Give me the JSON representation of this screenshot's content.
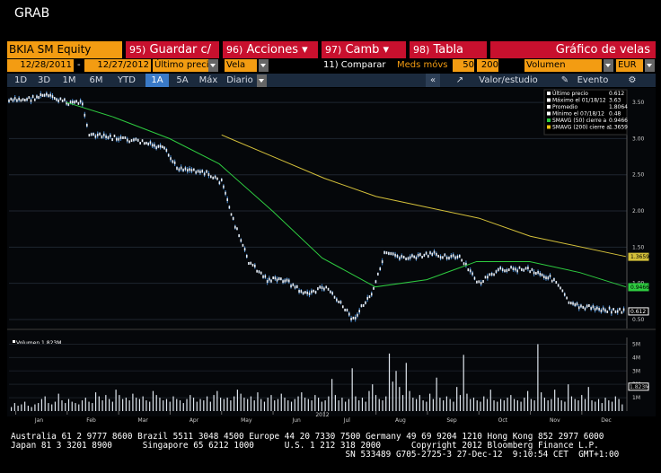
{
  "header": {
    "title": "GRAB"
  },
  "toolbar": {
    "ticker": "BKIA SM Equity",
    "buttons": [
      {
        "num": "95)",
        "label": "Guardar c/"
      },
      {
        "num": "96)",
        "label": "Acciones"
      },
      {
        "num": "97)",
        "label": "Camb"
      },
      {
        "num": "98)",
        "label": "Tabla"
      }
    ],
    "chart_title": "Gráfico de velas"
  },
  "settings": {
    "start_date": "12/28/2011",
    "end_date": "12/27/2012",
    "price_field": "Último preci",
    "chart_style": "Vela",
    "compare": "11) Comparar",
    "ma_label": "Meds móvs",
    "ma1": "50",
    "ma2": "200",
    "lower_field": "Volumen",
    "currency": "EUR"
  },
  "periods": [
    "1D",
    "3D",
    "1M",
    "6M",
    "YTD",
    "1A",
    "5A",
    "Máx"
  ],
  "selected_period": "1A",
  "frequency": "Diario",
  "study_label": "Valor/estudio",
  "event_label": "Evento",
  "colors": {
    "accent": "#f39c12",
    "red": "#c8102e",
    "bar": "#1b2a3d",
    "candle": "#5b9bd5",
    "sma50": "#2ecc40",
    "sma200": "#d4c03a"
  },
  "chart_data": {
    "type": "line",
    "x_ticks": [
      "Jan",
      "Feb",
      "Mar",
      "Apr",
      "May",
      "Jun",
      "Jul",
      "Aug",
      "Sep",
      "Oct",
      "Nov",
      "Dec"
    ],
    "year_label": "2012",
    "y_ticks": [
      "3.50",
      "3.00",
      "2.50",
      "2.00",
      "1.50",
      "1.00",
      "0.50"
    ],
    "ylim": [
      0.45,
      3.6
    ],
    "legend": [
      {
        "label": "Último precio",
        "value": "0.612"
      },
      {
        "label": "Máximo el 01/18/12",
        "value": "3.63"
      },
      {
        "label": "Promedio",
        "value": "1.8064"
      },
      {
        "label": "Mínimo el 07/18/12",
        "value": "0.48"
      },
      {
        "label": "SMAVG (50) cierre a",
        "value": "0.9466"
      },
      {
        "label": "SMAVG (200) cierre a",
        "value": "1.3659"
      }
    ],
    "right_labels": [
      "1.3659",
      "0.9466",
      "0.612"
    ],
    "price": [
      {
        "x": "Dec 28",
        "y": 3.52
      },
      {
        "x": "Jan 10",
        "y": 3.55
      },
      {
        "x": "Jan 18",
        "y": 3.6
      },
      {
        "x": "Jan 31",
        "y": 3.5
      },
      {
        "x": "Feb 10",
        "y": 3.5
      },
      {
        "x": "Feb 14",
        "y": 3.05
      },
      {
        "x": "Mar 01",
        "y": 3.0
      },
      {
        "x": "Mar 15",
        "y": 2.95
      },
      {
        "x": "Mar 28",
        "y": 2.85
      },
      {
        "x": "Apr 05",
        "y": 2.6
      },
      {
        "x": "Apr 20",
        "y": 2.55
      },
      {
        "x": "May 01",
        "y": 2.4
      },
      {
        "x": "May 09",
        "y": 1.8
      },
      {
        "x": "May 17",
        "y": 1.3
      },
      {
        "x": "May 28",
        "y": 1.05
      },
      {
        "x": "Jun 08",
        "y": 1.05
      },
      {
        "x": "Jun 20",
        "y": 0.85
      },
      {
        "x": "Jul 02",
        "y": 0.95
      },
      {
        "x": "Jul 18",
        "y": 0.5
      },
      {
        "x": "Jul 30",
        "y": 0.9
      },
      {
        "x": "Aug 06",
        "y": 1.4
      },
      {
        "x": "Aug 20",
        "y": 1.35
      },
      {
        "x": "Sep 05",
        "y": 1.4
      },
      {
        "x": "Sep 20",
        "y": 1.35
      },
      {
        "x": "Oct 01",
        "y": 1.0
      },
      {
        "x": "Oct 15",
        "y": 1.2
      },
      {
        "x": "Oct 30",
        "y": 1.2
      },
      {
        "x": "Nov 15",
        "y": 1.05
      },
      {
        "x": "Nov 25",
        "y": 0.7
      },
      {
        "x": "Dec 10",
        "y": 0.65
      },
      {
        "x": "Dec 27",
        "y": 0.61
      }
    ],
    "sma50": [
      {
        "x": "Jan 31",
        "y": 3.5
      },
      {
        "x": "Feb 28",
        "y": 3.3
      },
      {
        "x": "Mar 31",
        "y": 3.0
      },
      {
        "x": "Apr 30",
        "y": 2.65
      },
      {
        "x": "May 31",
        "y": 2.0
      },
      {
        "x": "Jun 30",
        "y": 1.35
      },
      {
        "x": "Jul 31",
        "y": 0.95
      },
      {
        "x": "Aug 31",
        "y": 1.05
      },
      {
        "x": "Sep 30",
        "y": 1.3
      },
      {
        "x": "Oct 31",
        "y": 1.3
      },
      {
        "x": "Nov 30",
        "y": 1.15
      },
      {
        "x": "Dec 27",
        "y": 0.95
      }
    ],
    "sma200": [
      {
        "x": "May 01",
        "y": 3.05
      },
      {
        "x": "Jun 01",
        "y": 2.75
      },
      {
        "x": "Jul 01",
        "y": 2.45
      },
      {
        "x": "Aug 01",
        "y": 2.2
      },
      {
        "x": "Sep 01",
        "y": 2.05
      },
      {
        "x": "Oct 01",
        "y": 1.9
      },
      {
        "x": "Nov 01",
        "y": 1.65
      },
      {
        "x": "Dec 27",
        "y": 1.37
      }
    ],
    "volume_label": "Volumen 1.823M",
    "volume_ticks": [
      "5M",
      "4M",
      "3M",
      "2M",
      "1M"
    ],
    "volume_last": "1.823M",
    "volume": [
      0.3,
      0.6,
      0.4,
      0.5,
      0.7,
      0.4,
      0.3,
      0.5,
      0.6,
      0.9,
      1.1,
      0.6,
      0.5,
      0.7,
      1.3,
      0.8,
      0.6,
      0.9,
      0.7,
      0.6,
      0.5,
      0.8,
      1.0,
      0.7,
      0.6,
      1.4,
      1.1,
      0.8,
      1.2,
      0.9,
      0.7,
      1.6,
      1.2,
      0.9,
      1.0,
      0.8,
      1.3,
      1.0,
      0.9,
      1.1,
      0.8,
      0.7,
      1.5,
      1.2,
      1.0,
      0.8,
      0.9,
      0.7,
      1.1,
      0.9,
      0.8,
      0.6,
      0.9,
      1.2,
      1.0,
      0.7,
      0.9,
      0.8,
      1.1,
      0.7,
      1.2,
      1.5,
      1.0,
      0.9,
      1.0,
      0.8,
      1.1,
      1.6,
      1.3,
      1.0,
      0.9,
      1.1,
      0.8,
      1.4,
      0.9,
      0.7,
      1.0,
      1.2,
      0.8,
      0.9,
      1.3,
      1.0,
      0.8,
      0.7,
      0.9,
      1.1,
      1.4,
      1.0,
      0.9,
      0.8,
      1.2,
      1.0,
      0.7,
      0.8,
      1.1,
      2.4,
      1.2,
      0.8,
      1.0,
      0.7,
      0.9,
      3.2,
      1.1,
      0.8,
      1.0,
      0.7,
      1.5,
      2.0,
      1.2,
      0.9,
      0.8,
      1.1,
      4.3,
      2.2,
      3.0,
      1.8,
      1.2,
      3.6,
      1.5,
      1.0,
      0.9,
      1.2,
      0.8,
      0.7,
      1.3,
      0.9,
      2.5,
      1.0,
      0.8,
      1.1,
      0.9,
      0.7,
      1.8,
      1.2,
      4.2,
      1.3,
      0.9,
      1.0,
      0.8,
      0.7,
      1.1,
      0.9,
      1.6,
      0.8,
      0.7,
      0.9,
      0.8,
      1.0,
      1.2,
      0.9,
      0.8,
      0.7,
      1.0,
      1.5,
      0.9,
      0.8,
      5.0,
      1.4,
      1.0,
      0.8,
      0.9,
      1.6,
      1.0,
      0.8,
      0.7,
      2.0,
      1.1,
      0.9,
      0.8,
      1.2,
      0.9,
      1.8,
      0.8,
      0.7,
      0.9,
      0.6,
      1.0,
      0.8,
      0.7,
      1.1,
      0.9,
      0.5
    ]
  },
  "footer": {
    "line1": "Australia 61 2 9777 8600 Brazil 5511 3048 4500 Europe 44 20 7330 7500 Germany 49 69 9204 1210 Hong Kong 852 2977 6000",
    "line2": "Japan 81 3 3201 8900      Singapore 65 6212 1000      U.S. 1 212 318 2000      Copyright 2012 Bloomberg Finance L.P.",
    "line3": "                                                                  SN 533489 G705-2725-3 27-Dec-12  9:10:54 CET  GMT+1:00"
  }
}
